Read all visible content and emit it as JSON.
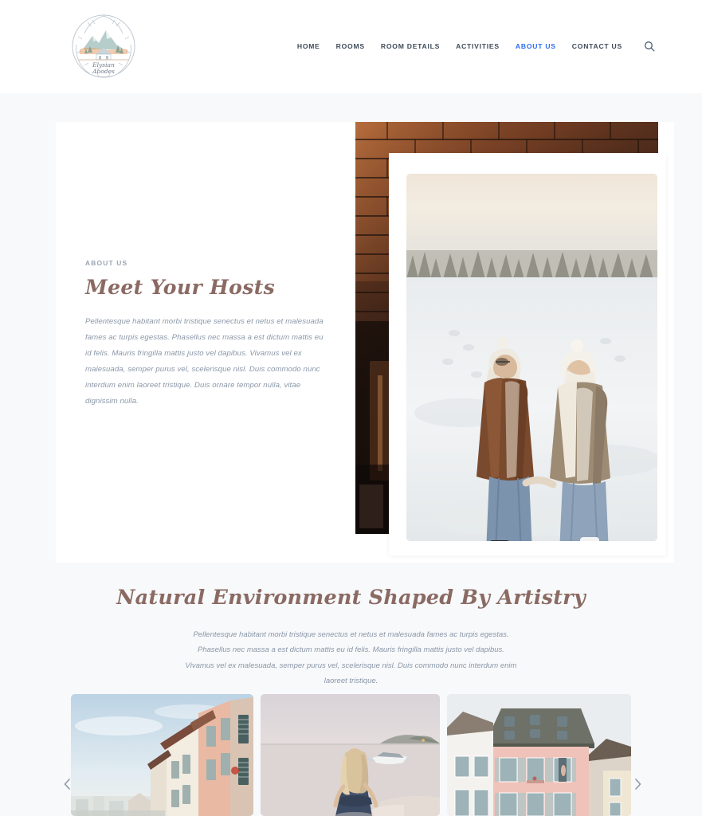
{
  "site": {
    "logo_name": "logo-elysian-abodes",
    "logo_text_line1": "Elysian",
    "logo_text_line2": "Abodes"
  },
  "header": {
    "nav": [
      {
        "label": "HOME",
        "active": false
      },
      {
        "label": "ROOMS",
        "active": false
      },
      {
        "label": "ROOM DETAILS",
        "active": false
      },
      {
        "label": "ACTIVITIES",
        "active": false
      },
      {
        "label": "ABOUT US",
        "active": true
      },
      {
        "label": "CONTACT US",
        "active": false
      }
    ],
    "search_icon": "search-icon",
    "active_color": "#2f6df6",
    "nav_color": "#3f4a59"
  },
  "about": {
    "eyebrow": "ABOUT US",
    "heading": "Meet Your Hosts",
    "paragraph": "Pellentesque habitant morbi tristique senectus et netus et malesuada fames ac turpis egestas. Phasellus nec massa a est dictum mattis eu id felis. Mauris fringilla mattis justo vel dapibus. Vivamus vel ex malesuada, semper purus vel, scelerisque nisl. Duis commodo nunc interdum enim laoreet tristique. Duis ornare tempor nulla, vitae dignissim nulla.",
    "heading_color": "#8a6a63",
    "text_color": "#8a97a8",
    "back_image_alt": "dark-brick-wall-interior",
    "front_image_alt": "couple-ice-skating-on-frozen-lake"
  },
  "nature": {
    "heading": "Natural Environment Shaped By Artistry",
    "paragraph": "Pellentesque habitant morbi tristique senectus et netus et malesuada fames ac turpis egestas. Phasellus nec massa a est dictum mattis eu id felis. Mauris fringilla mattis justo vel dapibus. Vivamus vel ex malesuada, semper purus vel, scelerisque nisl. Duis commodo nunc interdum enim laoreet tristique."
  },
  "gallery": {
    "prev_label": "‹",
    "next_label": "›",
    "items": [
      {
        "alt": "european-street-buildings-blue-sky"
      },
      {
        "alt": "woman-walking-on-beach-at-dusk"
      },
      {
        "alt": "pink-and-white-townhouses-with-dormer-windows"
      }
    ]
  },
  "colors": {
    "page_bg": "#f8f9fb",
    "card_bg": "#ffffff",
    "script_brown": "#8a6a63",
    "muted_blue": "#8a97a8"
  }
}
